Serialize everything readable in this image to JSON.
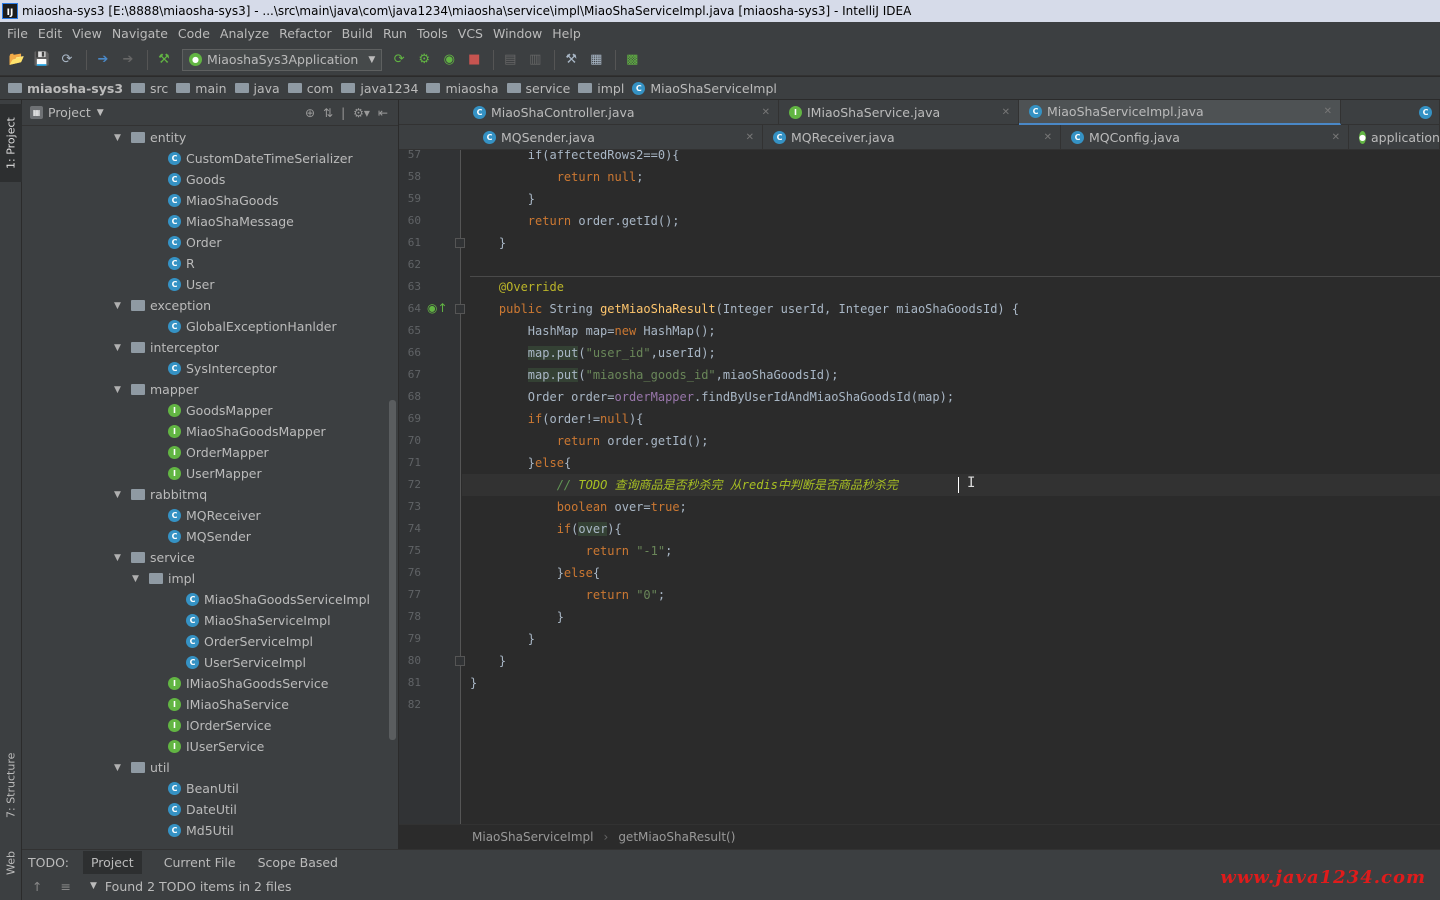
{
  "window": {
    "title": "miaosha-sys3 [E:\\8888\\miaosha-sys3] - ...\\src\\main\\java\\com\\java1234\\miaosha\\service\\impl\\MiaoShaServiceImpl.java [miaosha-sys3] - IntelliJ IDEA",
    "app_icon": "IJ"
  },
  "menu": [
    "File",
    "Edit",
    "View",
    "Navigate",
    "Code",
    "Analyze",
    "Refactor",
    "Build",
    "Run",
    "Tools",
    "VCS",
    "Window",
    "Help"
  ],
  "toolbar": {
    "run_config": "MiaoshaSys3Application"
  },
  "navbar": {
    "crumbs": [
      "miaosha-sys3",
      "src",
      "main",
      "java",
      "com",
      "java1234",
      "miaosha",
      "service",
      "impl",
      "MiaoShaServiceImpl"
    ]
  },
  "side_tabs": {
    "project": "1: Project",
    "structure": "7: Structure",
    "web": "Web"
  },
  "project_panel": {
    "title": "Project",
    "tree": [
      {
        "label": "entity",
        "type": "folder",
        "depth": 0,
        "expanded": true
      },
      {
        "label": "CustomDateTimeSerializer",
        "type": "class",
        "depth": 1
      },
      {
        "label": "Goods",
        "type": "class",
        "depth": 1
      },
      {
        "label": "MiaoShaGoods",
        "type": "class",
        "depth": 1
      },
      {
        "label": "MiaoShaMessage",
        "type": "class",
        "depth": 1
      },
      {
        "label": "Order",
        "type": "class",
        "depth": 1
      },
      {
        "label": "R",
        "type": "class",
        "depth": 1
      },
      {
        "label": "User",
        "type": "class",
        "depth": 1
      },
      {
        "label": "exception",
        "type": "folder",
        "depth": 0,
        "expanded": true
      },
      {
        "label": "GlobalExceptionHanlder",
        "type": "class",
        "depth": 1
      },
      {
        "label": "interceptor",
        "type": "folder",
        "depth": 0,
        "expanded": true
      },
      {
        "label": "SysInterceptor",
        "type": "class",
        "depth": 1
      },
      {
        "label": "mapper",
        "type": "folder",
        "depth": 0,
        "expanded": true
      },
      {
        "label": "GoodsMapper",
        "type": "interface",
        "depth": 1
      },
      {
        "label": "MiaoShaGoodsMapper",
        "type": "interface",
        "depth": 1
      },
      {
        "label": "OrderMapper",
        "type": "interface",
        "depth": 1
      },
      {
        "label": "UserMapper",
        "type": "interface",
        "depth": 1
      },
      {
        "label": "rabbitmq",
        "type": "folder",
        "depth": 0,
        "expanded": true
      },
      {
        "label": "MQReceiver",
        "type": "class",
        "depth": 1
      },
      {
        "label": "MQSender",
        "type": "class",
        "depth": 1
      },
      {
        "label": "service",
        "type": "folder",
        "depth": 0,
        "expanded": true
      },
      {
        "label": "impl",
        "type": "folder",
        "depth": 1,
        "expanded": true
      },
      {
        "label": "MiaoShaGoodsServiceImpl",
        "type": "class",
        "depth": 2
      },
      {
        "label": "MiaoShaServiceImpl",
        "type": "class",
        "depth": 2
      },
      {
        "label": "OrderServiceImpl",
        "type": "class",
        "depth": 2
      },
      {
        "label": "UserServiceImpl",
        "type": "class",
        "depth": 2
      },
      {
        "label": "IMiaoShaGoodsService",
        "type": "interface",
        "depth": 1
      },
      {
        "label": "IMiaoShaService",
        "type": "interface",
        "depth": 1
      },
      {
        "label": "IOrderService",
        "type": "interface",
        "depth": 1
      },
      {
        "label": "IUserService",
        "type": "interface",
        "depth": 1
      },
      {
        "label": "util",
        "type": "folder",
        "depth": 0,
        "expanded": true
      },
      {
        "label": "BeanUtil",
        "type": "class",
        "depth": 1
      },
      {
        "label": "DateUtil",
        "type": "class",
        "depth": 1
      },
      {
        "label": "Md5Util",
        "type": "class",
        "depth": 1
      }
    ]
  },
  "editor_tabs": {
    "row1": [
      {
        "label": "MiaoShaController.java",
        "icon": "class",
        "active": false
      },
      {
        "label": "IMiaoShaService.java",
        "icon": "interface",
        "active": false
      },
      {
        "label": "MiaoShaServiceImpl.java",
        "icon": "class",
        "active": true
      }
    ],
    "row2": [
      {
        "label": "MQSender.java",
        "icon": "class",
        "active": false
      },
      {
        "label": "MQReceiver.java",
        "icon": "class",
        "active": false
      },
      {
        "label": "MQConfig.java",
        "icon": "class",
        "active": false
      },
      {
        "label": "application",
        "icon": "spring",
        "active": false
      }
    ]
  },
  "code": {
    "lines": [
      {
        "n": "57",
        "html": "        if(affectedRows2==0){"
      },
      {
        "n": "58",
        "html": "            <span class=\"kw\">return null</span>;"
      },
      {
        "n": "59",
        "html": "        }"
      },
      {
        "n": "60",
        "html": "        <span class=\"kw\">return</span> order.getId();"
      },
      {
        "n": "61",
        "html": "    }"
      },
      {
        "n": "62",
        "html": ""
      },
      {
        "n": "63",
        "html": "    <span class=\"ann\">@Override</span>"
      },
      {
        "n": "64",
        "html": "    <span class=\"kw\">public</span> String <span class=\"fn\">getMiaoShaResult</span>(Integer userId, Integer miaoShaGoodsId) {"
      },
      {
        "n": "65",
        "html": "        HashMap map=<span class=\"kw\">new</span> HashMap();"
      },
      {
        "n": "66",
        "html": "        <span class=\"hlvar\">map.put</span>(<span class=\"str\">\"user_id\"</span>,userId);"
      },
      {
        "n": "67",
        "html": "        <span class=\"hlvar\">map.put</span>(<span class=\"str\">\"miaosha_goods_id\"</span>,miaoShaGoodsId);"
      },
      {
        "n": "68",
        "html": "        Order order=<span class=\"fld\">orderMapper</span>.findByUserIdAndMiaoShaGoodsId(map);"
      },
      {
        "n": "69",
        "html": "        <span class=\"kw\">if</span>(order!=<span class=\"kw\">null</span>){"
      },
      {
        "n": "70",
        "html": "            <span class=\"kw\">return</span> order.getId();"
      },
      {
        "n": "71",
        "html": "        }<span class=\"kw\">else</span>{"
      },
      {
        "n": "72",
        "html": "            <span class=\"cmt\">// </span><span class=\"todo\">TODO 查询商品是否秒杀完 从redis中判断是否商品秒杀完</span>"
      },
      {
        "n": "73",
        "html": "            <span class=\"kw\">boolean</span> over=<span class=\"kw\">true</span>;"
      },
      {
        "n": "74",
        "html": "            <span class=\"kw\">if</span>(<span class=\"hlvar\">over</span>){"
      },
      {
        "n": "75",
        "html": "                <span class=\"kw\">return</span> <span class=\"str\">\"-1\"</span>;"
      },
      {
        "n": "76",
        "html": "            }<span class=\"kw\">else</span>{"
      },
      {
        "n": "77",
        "html": "                <span class=\"kw\">return</span> <span class=\"str\">\"0\"</span>;"
      },
      {
        "n": "78",
        "html": "            }"
      },
      {
        "n": "79",
        "html": "        }"
      },
      {
        "n": "80",
        "html": "    }"
      },
      {
        "n": "81",
        "html": "}"
      },
      {
        "n": "82",
        "html": ""
      }
    ],
    "current_line": "72"
  },
  "editor_breadcrumb": {
    "class_name": "MiaoShaServiceImpl",
    "method_name": "getMiaoShaResult()"
  },
  "todo_panel": {
    "label": "TODO:",
    "tabs": [
      "Project",
      "Current File",
      "Scope Based"
    ],
    "found": "Found 2 TODO items in 2 files"
  },
  "watermark": "www.java1234.com"
}
